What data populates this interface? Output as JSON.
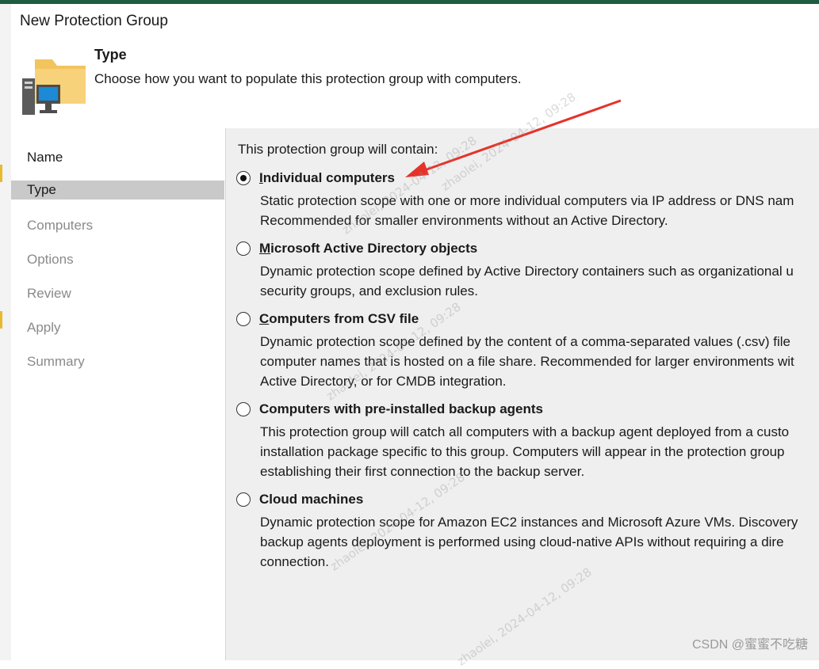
{
  "window": {
    "title": "New Protection Group"
  },
  "header": {
    "heading": "Type",
    "description": "Choose how you want to populate this protection group with computers.",
    "icon": "computer-folder-icon"
  },
  "sidebar": {
    "items": [
      {
        "label": "Name",
        "state": "done"
      },
      {
        "label": "Type",
        "state": "active"
      },
      {
        "label": "Computers",
        "state": "disabled"
      },
      {
        "label": "Options",
        "state": "disabled"
      },
      {
        "label": "Review",
        "state": "disabled"
      },
      {
        "label": "Apply",
        "state": "disabled"
      },
      {
        "label": "Summary",
        "state": "disabled"
      }
    ]
  },
  "main": {
    "contain_label": "This protection group will contain:",
    "options": [
      {
        "title": "Individual computers",
        "selected": true,
        "lines": [
          "Static protection scope with one or more individual computers via IP address or DNS nam",
          "Recommended for smaller environments without an Active Directory."
        ]
      },
      {
        "title": "Microsoft Active Directory objects",
        "selected": false,
        "lines": [
          "Dynamic protection scope defined by Active Directory containers such as organizational u",
          "security groups, and exclusion rules."
        ]
      },
      {
        "title": "Computers from CSV file",
        "selected": false,
        "lines": [
          "Dynamic protection scope defined by the content of a comma-separated values (.csv) file",
          "computer names that is hosted on a file share. Recommended for larger environments wit",
          "Active Directory, or for CMDB integration."
        ]
      },
      {
        "title": "Computers with pre-installed backup agents",
        "selected": false,
        "lines": [
          "This protection group will catch all computers with a backup agent deployed from a custo",
          "installation package specific to this group.  Computers will appear in the protection group",
          "establishing their first connection to the backup server."
        ]
      },
      {
        "title": "Cloud machines",
        "selected": false,
        "lines": [
          "Dynamic protection scope for Amazon EC2 instances and Microsoft Azure VMs. Discovery",
          "backup agents deployment is performed using cloud-native APIs without requiring a dire",
          "connection."
        ]
      }
    ]
  },
  "watermark": {
    "text": "zhaolei, 2024-04-12, 09:28",
    "csdn": "CSDN @蜜蜜不吃糖"
  },
  "colors": {
    "top_bar": "#1e5b43",
    "annotation_arrow": "#e5332a",
    "active_nav": "#c9c9c9",
    "content_bg": "#efefef"
  }
}
